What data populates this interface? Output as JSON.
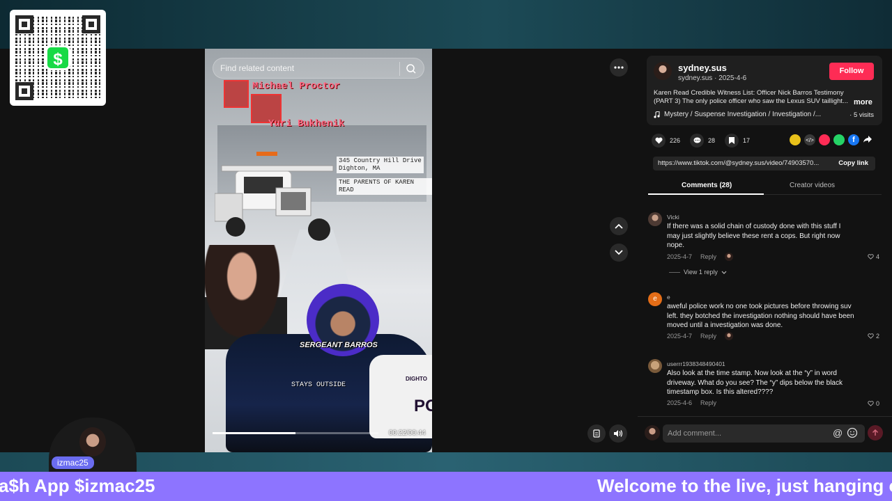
{
  "overlay": {
    "streamer_tag": "izmac25",
    "ticker_left": "a$h App $izmac25",
    "ticker_right": "Welcome to the live, just hanging ou"
  },
  "video": {
    "search_placeholder": "Find related content",
    "labels": {
      "name1": "Michael Proctor",
      "name2": "Yuri Bukhenik",
      "address_line1": "345 Country Hill Drive",
      "address_line2": "Dighton, MA",
      "parents": "THE PARENTS OF KAREN READ",
      "sergeant": "SERGEANT BARROS",
      "stays_outside": "STAYS OUTSIDE",
      "car_text": "DIGHTO",
      "car_text2": "PO"
    },
    "progress_fraction": 0.5,
    "timecode": "00:22/00:44"
  },
  "panel": {
    "author": {
      "name": "sydney.sus",
      "handle": "sydney.sus",
      "date": "2025-4-6",
      "follow_label": "Follow"
    },
    "description": "Karen Read Credible Witness List: Officer Nick Barros Testimony (PART 3) The only police officer who saw the Lexus SUV taillight...",
    "more_label": "more",
    "music": "Mystery / Suspense Investigation / Investigation /...",
    "visits": "· 5 visits",
    "stats": {
      "likes": "226",
      "comments": "28",
      "saves": "17"
    },
    "link": {
      "url": "https://www.tiktok.com/@sydney.sus/video/74903570...",
      "copy_label": "Copy link"
    },
    "tabs": {
      "comments": "Comments (28)",
      "creator": "Creator videos"
    },
    "comments": [
      {
        "user": "Vicki",
        "text": "If there was a solid chain of custody done with this stuff I may just slightly believe these rent a cops. But right now nope.",
        "date": "2025-4-7",
        "reply": "Reply",
        "likes": "4",
        "view_replies": "View 1 reply"
      },
      {
        "user": "e",
        "initial": "e",
        "text": "aweful police work no one took pictures before throwing suv left. they botched the investigation nothing should have been moved until a investigation was done.",
        "date": "2025-4-7",
        "reply": "Reply",
        "likes": "2"
      },
      {
        "user": "userrr1938348490401",
        "text": "Also look at the time stamp. Now look at the “y” in word driveway. What do you see? The “y” dips below the black timestamp box. Is this altered????",
        "date": "2025-4-6",
        "reply": "Reply",
        "likes": "0"
      }
    ],
    "comment_input": {
      "placeholder": "Add comment...",
      "at": "@"
    }
  }
}
